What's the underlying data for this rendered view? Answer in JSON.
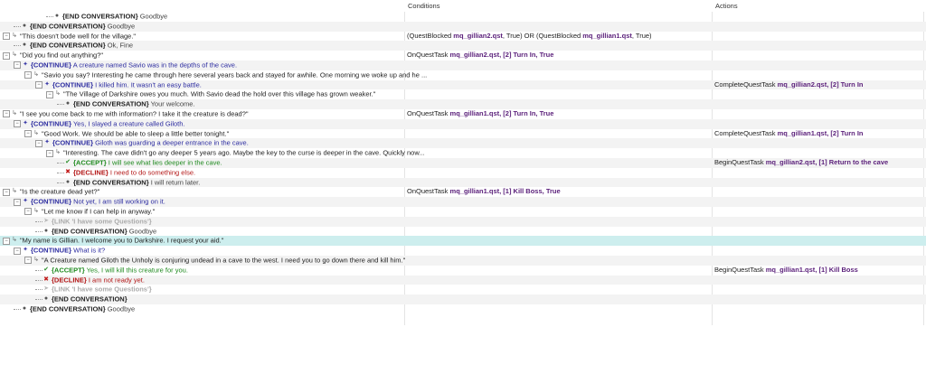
{
  "header": {
    "conditions_label": "Conditions",
    "actions_label": "Actions"
  },
  "rows": [
    {
      "indent": 4,
      "icon": "end",
      "kw": "{END CONVERSATION}",
      "text": "Goodbye",
      "kind": "end",
      "cond": [],
      "act": []
    },
    {
      "indent": 1,
      "icon": "end",
      "kw": "{END CONVERSATION}",
      "text": "Goodbye",
      "kind": "end",
      "cond": [],
      "act": []
    },
    {
      "indent": 0,
      "exp": true,
      "icon": "q",
      "kw": "",
      "text": "\"This doesn't bode well for the village.\"",
      "kind": "q",
      "cond": [
        {
          "t": "(QuestBlocked ",
          "c": "cmd"
        },
        {
          "t": "mq_gillian2.qst",
          "c": "qst"
        },
        {
          "t": ", True) OR (QuestBlocked ",
          "c": "cmd"
        },
        {
          "t": "mq_gillian1.qst",
          "c": "qst"
        },
        {
          "t": ", True)",
          "c": "cmd"
        }
      ],
      "act": []
    },
    {
      "indent": 1,
      "icon": "end",
      "kw": "{END CONVERSATION}",
      "text": "Ok, Fine",
      "kind": "end",
      "cond": [],
      "act": []
    },
    {
      "indent": 0,
      "exp": true,
      "icon": "q",
      "kw": "",
      "text": "\"Did you find out anything?\"",
      "kind": "q",
      "cond": [
        {
          "t": "OnQuestTask ",
          "c": "cmd"
        },
        {
          "t": "mq_gillian2.qst",
          "c": "qst"
        },
        {
          "t": ", [2] Turn In, True",
          "c": "hl"
        }
      ],
      "act": []
    },
    {
      "indent": 1,
      "exp": true,
      "icon": "cont",
      "kw": "{CONTINUE}",
      "text": "A creature named Savio was in the depths of the cave.",
      "kind": "cont",
      "cond": [],
      "act": []
    },
    {
      "indent": 2,
      "exp": true,
      "icon": "q",
      "kw": "",
      "text": "\"Savio you say? Interesting he came through here several years back and stayed for awhile. One morning we woke up and he ...",
      "kind": "q",
      "cond": [],
      "act": []
    },
    {
      "indent": 3,
      "exp": true,
      "icon": "cont",
      "kw": "{CONTINUE}",
      "text": "I killed him.  It wasn't an easy battle.",
      "kind": "cont",
      "cond": [],
      "act": [
        {
          "t": "CompleteQuestTask ",
          "c": "cmd"
        },
        {
          "t": "mq_gillian2.qst",
          "c": "qst"
        },
        {
          "t": ", [2] Turn In",
          "c": "hl"
        }
      ]
    },
    {
      "indent": 4,
      "exp": true,
      "icon": "q",
      "kw": "",
      "text": "\"The Village of Darkshire owes you much. With Savio dead the hold over this village has grown weaker.\"",
      "kind": "q",
      "cond": [],
      "act": []
    },
    {
      "indent": 5,
      "icon": "end",
      "kw": "{END CONVERSATION}",
      "text": "Your welcome.",
      "kind": "end",
      "cond": [],
      "act": []
    },
    {
      "indent": 0,
      "exp": true,
      "icon": "q",
      "kw": "",
      "text": "\"I see you come back to me with information? I take it the creature is dead?\"",
      "kind": "q",
      "cond": [
        {
          "t": "OnQuestTask ",
          "c": "cmd"
        },
        {
          "t": "mq_gillian1.qst",
          "c": "qst"
        },
        {
          "t": ", [2] Turn In, True",
          "c": "hl"
        }
      ],
      "act": []
    },
    {
      "indent": 1,
      "exp": true,
      "icon": "cont",
      "kw": "{CONTINUE}",
      "text": "Yes, I slayed a creature called Giloth.",
      "kind": "cont",
      "cond": [],
      "act": []
    },
    {
      "indent": 2,
      "exp": true,
      "icon": "q",
      "kw": "",
      "text": "\"Good Work. We should be able to sleep a little better tonight.\"",
      "kind": "q",
      "cond": [],
      "act": [
        {
          "t": "CompleteQuestTask ",
          "c": "cmd"
        },
        {
          "t": "mq_gillian1.qst",
          "c": "qst"
        },
        {
          "t": ", [2] Turn In",
          "c": "hl"
        }
      ]
    },
    {
      "indent": 3,
      "exp": true,
      "icon": "cont",
      "kw": "{CONTINUE}",
      "text": "Giloth was guarding a deeper entrance in the cave.",
      "kind": "cont",
      "cond": [],
      "act": []
    },
    {
      "indent": 4,
      "exp": true,
      "icon": "q",
      "kw": "",
      "text": "\"Interesting.  The cave didn't go any deeper 5 years ago.  Maybe the key to the curse is deeper in the cave. Quickly now...",
      "kind": "q",
      "cond": [],
      "act": []
    },
    {
      "indent": 5,
      "icon": "acc",
      "kw": "{ACCEPT}",
      "text": "I will see what lies deeper in the cave.",
      "kind": "acc",
      "cond": [],
      "act": [
        {
          "t": "BeginQuestTask ",
          "c": "cmd"
        },
        {
          "t": "mq_gillian2.qst",
          "c": "qst"
        },
        {
          "t": ", [1] Return to the cave",
          "c": "hl"
        }
      ]
    },
    {
      "indent": 5,
      "icon": "dec",
      "kw": "{DECLINE}",
      "text": "I need to do something else.",
      "kind": "dec",
      "cond": [],
      "act": []
    },
    {
      "indent": 5,
      "icon": "end",
      "kw": "{END CONVERSATION}",
      "text": "I will return later.",
      "kind": "end",
      "cond": [],
      "act": []
    },
    {
      "indent": 0,
      "exp": true,
      "icon": "q",
      "kw": "",
      "text": "\"Is the creature dead yet?\"",
      "kind": "q",
      "cond": [
        {
          "t": "OnQuestTask ",
          "c": "cmd"
        },
        {
          "t": "mq_gillian1.qst",
          "c": "qst"
        },
        {
          "t": ", [1] Kill Boss, True",
          "c": "hl"
        }
      ],
      "act": []
    },
    {
      "indent": 1,
      "exp": true,
      "icon": "cont",
      "kw": "{CONTINUE}",
      "text": "Not yet, I am still working on it.",
      "kind": "cont",
      "cond": [],
      "act": []
    },
    {
      "indent": 2,
      "exp": true,
      "icon": "q",
      "kw": "",
      "text": "\"Let me know if I can help in anyway.\"",
      "kind": "q",
      "cond": [],
      "act": []
    },
    {
      "indent": 3,
      "icon": "link",
      "kw": "{LINK 'I have some Questions'}",
      "text": "",
      "kind": "link",
      "cond": [],
      "act": []
    },
    {
      "indent": 3,
      "icon": "end",
      "kw": "{END CONVERSATION}",
      "text": "Goodbye",
      "kind": "end",
      "cond": [],
      "act": []
    },
    {
      "indent": 0,
      "exp": true,
      "icon": "q",
      "kw": "",
      "text": "\"My name is Gillian. I welcome you to Darkshire. I request your aid.\"",
      "kind": "q",
      "sel": true,
      "cond": [],
      "act": []
    },
    {
      "indent": 1,
      "exp": true,
      "icon": "cont",
      "kw": "{CONTINUE}",
      "text": "What is it?",
      "kind": "cont",
      "cond": [],
      "act": []
    },
    {
      "indent": 2,
      "exp": true,
      "icon": "q",
      "kw": "",
      "text": "\"A Creature named Giloth the Unholy is conjuring undead in a cave to the west. I need you to go down there and kill him.\"",
      "kind": "q",
      "cond": [],
      "act": []
    },
    {
      "indent": 3,
      "icon": "acc",
      "kw": "{ACCEPT}",
      "text": "Yes, I will kill this creature for you.",
      "kind": "acc",
      "cond": [],
      "act": [
        {
          "t": "BeginQuestTask ",
          "c": "cmd"
        },
        {
          "t": "mq_gillian1.qst",
          "c": "qst"
        },
        {
          "t": ", [1] Kill Boss",
          "c": "hl"
        }
      ]
    },
    {
      "indent": 3,
      "icon": "dec",
      "kw": "{DECLINE}",
      "text": "I am not ready yet.",
      "kind": "dec",
      "cond": [],
      "act": []
    },
    {
      "indent": 3,
      "icon": "link",
      "kw": "{LINK 'I have some Questions'}",
      "text": "",
      "kind": "link",
      "cond": [],
      "act": []
    },
    {
      "indent": 3,
      "icon": "end",
      "kw": "{END CONVERSATION}",
      "text": "",
      "kind": "end",
      "cond": [],
      "act": []
    },
    {
      "indent": 1,
      "icon": "end",
      "kw": "{END CONVERSATION}",
      "text": "Goodbye",
      "kind": "end",
      "cond": [],
      "act": []
    }
  ],
  "icons": {
    "q": "question-speech-icon",
    "cont": "continue-arrow-icon",
    "acc": "accept-check-icon",
    "dec": "decline-x-icon",
    "link": "link-arrow-icon",
    "end": "end-dot-icon"
  }
}
